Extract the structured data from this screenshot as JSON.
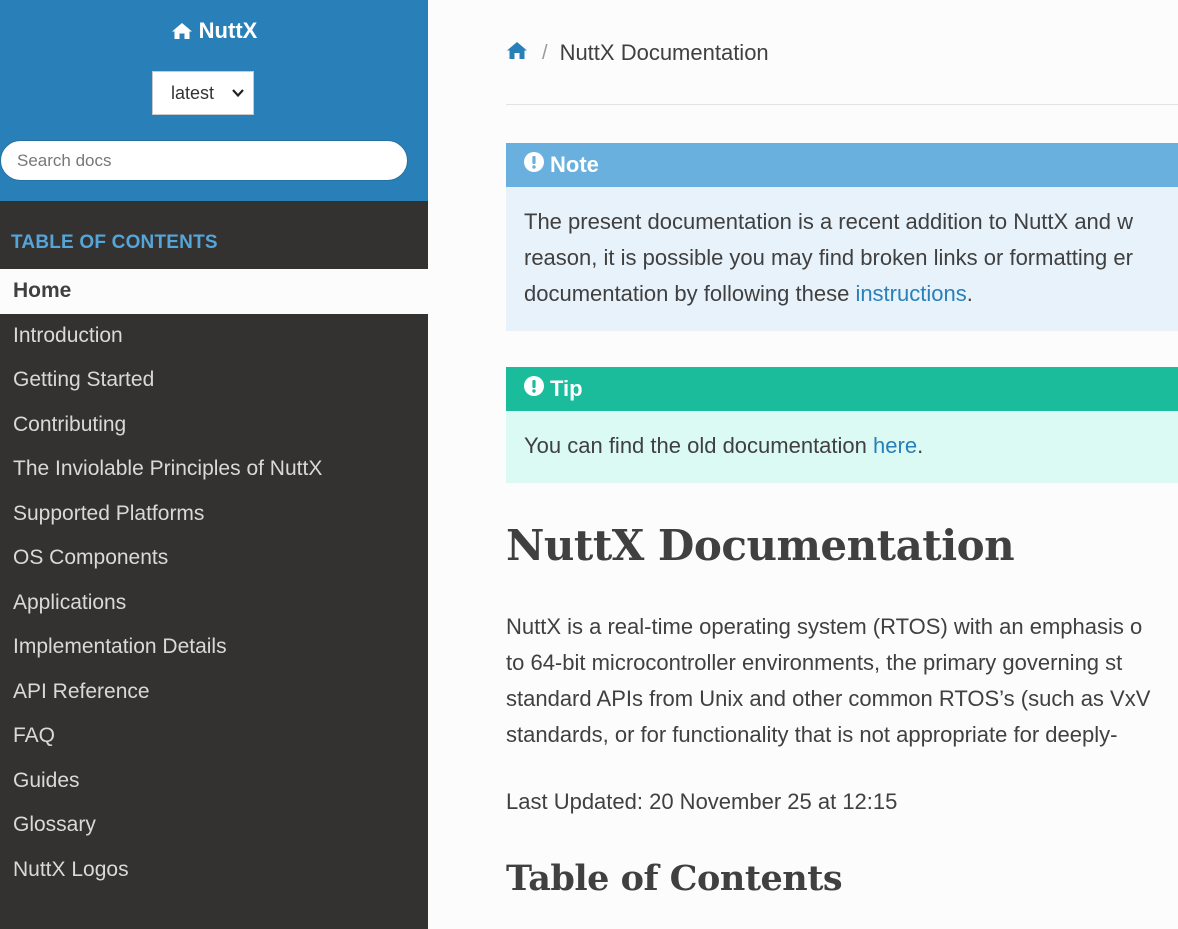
{
  "sidebar": {
    "brand": "NuttX",
    "version_selected": "latest",
    "search_placeholder": "Search docs",
    "toc_caption": "TABLE OF CONTENTS",
    "items": [
      {
        "label": "Home"
      },
      {
        "label": "Introduction"
      },
      {
        "label": "Getting Started"
      },
      {
        "label": "Contributing"
      },
      {
        "label": "The Inviolable Principles of NuttX"
      },
      {
        "label": "Supported Platforms"
      },
      {
        "label": "OS Components"
      },
      {
        "label": "Applications"
      },
      {
        "label": "Implementation Details"
      },
      {
        "label": "API Reference"
      },
      {
        "label": "FAQ"
      },
      {
        "label": "Guides"
      },
      {
        "label": "Glossary"
      },
      {
        "label": "NuttX Logos"
      }
    ]
  },
  "breadcrumb": {
    "current": "NuttX Documentation",
    "separator": "/"
  },
  "note": {
    "title": "Note",
    "line1": "The present documentation is a recent addition to NuttX and w",
    "line2": "reason, it is possible you may find broken links or formatting er",
    "line3_before": "documentation by following these ",
    "line3_link": "instructions",
    "line3_after": "."
  },
  "tip": {
    "title": "Tip",
    "text_before": "You can find the old documentation ",
    "link": "here",
    "text_after": "."
  },
  "main": {
    "title": "NuttX Documentation",
    "intro": [
      "NuttX is a real-time operating system (RTOS) with an emphasis o",
      "to 64-bit microcontroller environments, the primary governing st",
      "standard APIs from Unix and other common RTOS’s (such as VxV",
      "standards, or for functionality that is not appropriate for deeply-"
    ],
    "last_updated": "Last Updated: 20 November 25 at 12:15",
    "toc_heading": "Table of Contents"
  },
  "colors": {
    "sidebar_top": "#2980b9",
    "sidebar_bg": "#343131",
    "note_header": "#6ab0de",
    "note_body": "#e7f2fa",
    "tip_header": "#1abc9c",
    "tip_body": "#dbfaf4",
    "link": "#2980b9",
    "toc_caption": "#55a5d9"
  },
  "icons": {
    "brand": "home-icon",
    "breadcrumb_home": "home-icon",
    "note": "exclamation-circle-icon",
    "tip": "exclamation-circle-icon",
    "version_caret": "chevron-down-icon"
  }
}
